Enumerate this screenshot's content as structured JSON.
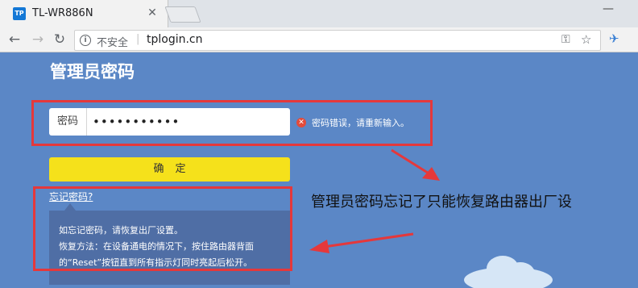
{
  "browser": {
    "tab_title": "TL-WR886N",
    "favicon_text": "TP",
    "close_glyph": "✕",
    "minimize_glyph": "—",
    "security_label": "不安全",
    "url": "tplogin.cn",
    "separator": "|"
  },
  "login": {
    "title": "管理员密码",
    "password_label": "密码",
    "password_value": "•••••••••••",
    "error_message": "密码错误，请重新输入。",
    "confirm_label": "确定",
    "forgot_link": "忘记密码?",
    "tip_lines": [
      "如忘记密码，请恢复出厂设置。",
      "恢复方法：在设备通电的情况下，按住路由器背面",
      "的“Reset”按钮直到所有指示灯同时亮起后松开。"
    ]
  },
  "annotation": {
    "text": "管理员密码忘记了只能恢复路由器出厂设"
  },
  "colors": {
    "page_background": "#5b87c6",
    "button_yellow": "#f5e11b",
    "annotation_red": "#e5383b",
    "tip_background": "#4f6ea5"
  },
  "icons": [
    "info-icon",
    "key-icon",
    "star-icon",
    "extension-icon",
    "error-icon",
    "cloud-icon",
    "arrow-icon"
  ]
}
